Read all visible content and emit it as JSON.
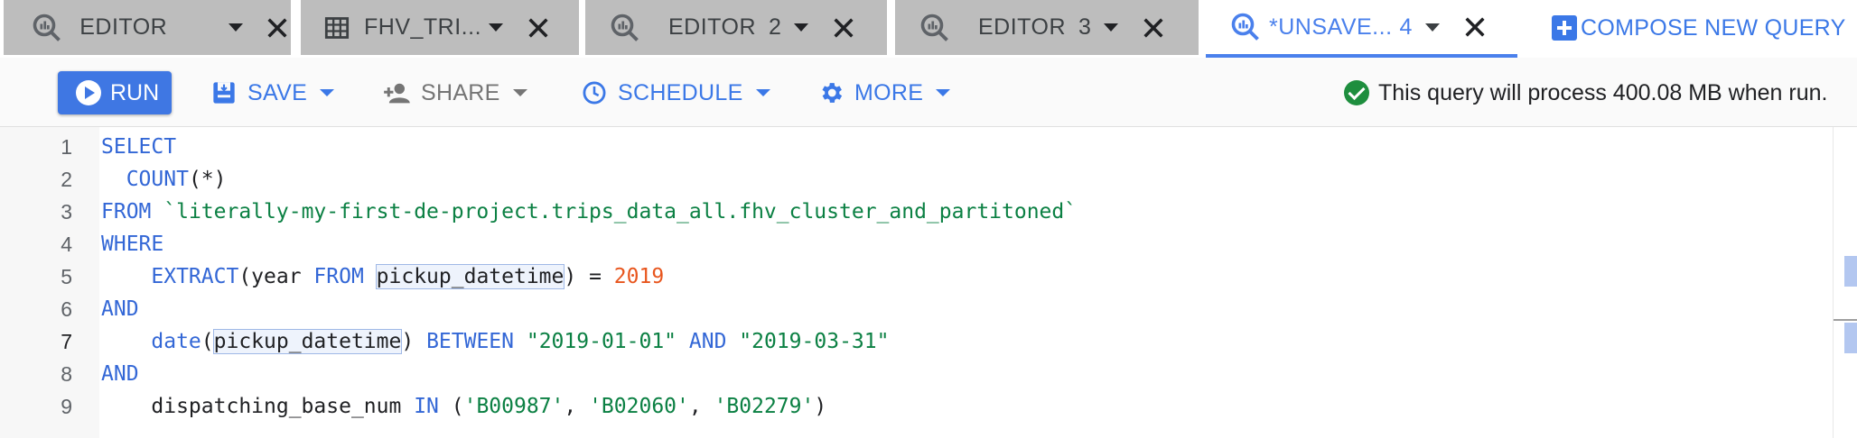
{
  "tabs": [
    {
      "label": "EDITOR",
      "number": "",
      "icon": "query-icon"
    },
    {
      "label": "FHV_TRI...",
      "number": "",
      "icon": "table-icon"
    },
    {
      "label": "EDITOR",
      "number": "2",
      "icon": "query-icon"
    },
    {
      "label": "EDITOR",
      "number": "3",
      "icon": "query-icon"
    },
    {
      "label": "*UNSAVE...",
      "number": "4",
      "icon": "query-icon"
    }
  ],
  "compose_label": "COMPOSE NEW QUERY",
  "toolbar": {
    "run": "RUN",
    "save": "SAVE",
    "share": "SHARE",
    "schedule": "SCHEDULE",
    "more": "MORE"
  },
  "status": "This query will process 400.08 MB when run.",
  "colors": {
    "accent": "#3b78e7",
    "keyword": "#3367d6",
    "string": "#0b8043",
    "number": "#e8561e",
    "status_ok": "#1e8e3e"
  },
  "editor": {
    "current_line": 7,
    "lines": [
      {
        "n": "1",
        "tokens": [
          {
            "t": "SELECT",
            "c": "kw"
          }
        ]
      },
      {
        "n": "2",
        "tokens": [
          {
            "t": "  "
          },
          {
            "t": "COUNT",
            "c": "kw"
          },
          {
            "t": "(*)"
          }
        ]
      },
      {
        "n": "3",
        "tokens": [
          {
            "t": "FROM",
            "c": "kw"
          },
          {
            "t": " "
          },
          {
            "t": "`literally-my-first-de-project.trips_data_all.fhv_cluster_and_partitoned`",
            "c": "str"
          }
        ]
      },
      {
        "n": "4",
        "tokens": [
          {
            "t": "WHERE",
            "c": "kw"
          }
        ]
      },
      {
        "n": "5",
        "tokens": [
          {
            "t": "    "
          },
          {
            "t": "EXTRACT",
            "c": "kw"
          },
          {
            "t": "(year "
          },
          {
            "t": "FROM",
            "c": "kw"
          },
          {
            "t": " "
          },
          {
            "t": "pickup_datetime",
            "c": "hl"
          },
          {
            "t": ") = "
          },
          {
            "t": "2019",
            "c": "num"
          }
        ]
      },
      {
        "n": "6",
        "tokens": [
          {
            "t": "AND",
            "c": "kw"
          }
        ]
      },
      {
        "n": "7",
        "tokens": [
          {
            "t": "    "
          },
          {
            "t": "date",
            "c": "kw"
          },
          {
            "t": "("
          },
          {
            "t": "",
            "c": "cursor"
          },
          {
            "t": "pickup_datetime",
            "c": "hl"
          },
          {
            "t": ") "
          },
          {
            "t": "BETWEEN",
            "c": "kw"
          },
          {
            "t": " "
          },
          {
            "t": "\"2019-01-01\"",
            "c": "str"
          },
          {
            "t": " "
          },
          {
            "t": "AND",
            "c": "kw"
          },
          {
            "t": " "
          },
          {
            "t": "\"2019-03-31\"",
            "c": "str"
          }
        ]
      },
      {
        "n": "8",
        "tokens": [
          {
            "t": "AND",
            "c": "kw"
          }
        ]
      },
      {
        "n": "9",
        "tokens": [
          {
            "t": "    dispatching_base_num "
          },
          {
            "t": "IN",
            "c": "kw"
          },
          {
            "t": " ("
          },
          {
            "t": "'B00987'",
            "c": "str"
          },
          {
            "t": ", "
          },
          {
            "t": "'B02060'",
            "c": "str"
          },
          {
            "t": ", "
          },
          {
            "t": "'B02279'",
            "c": "str"
          },
          {
            "t": ")"
          }
        ]
      }
    ]
  }
}
